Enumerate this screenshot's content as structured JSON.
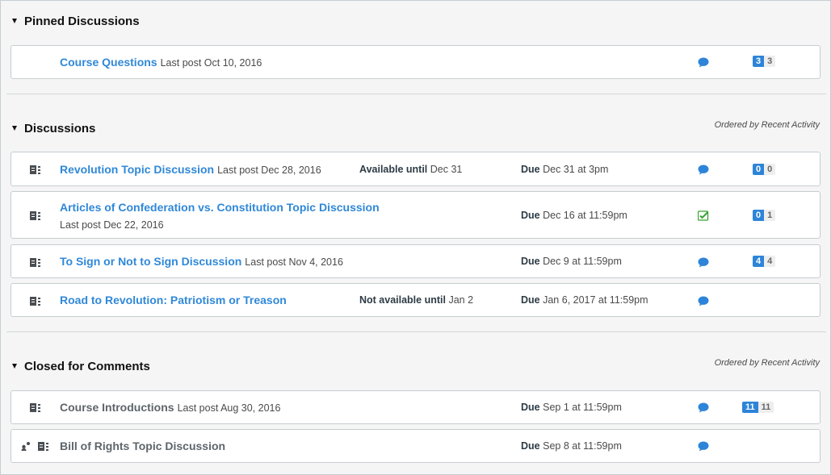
{
  "colors": {
    "link": "#3088d8",
    "badge_blue": "#2d84d8",
    "checked_green": "#37a22f",
    "subscribe_blue": "#2d84d8"
  },
  "pinned": {
    "title": "Pinned Discussions",
    "items": [
      {
        "title": "Course Questions",
        "last_post": "Last post Oct 10, 2016",
        "unread": "3",
        "total": "3",
        "status_icon": "speech-bubble-icon"
      }
    ]
  },
  "discussions": {
    "title": "Discussions",
    "ordered": "Ordered by Recent Activity",
    "items": [
      {
        "title": "Revolution Topic Discussion",
        "last_post": "Last post Dec 28, 2016",
        "avail_label": "Available until",
        "avail_date": "Dec 31",
        "due_label": "Due",
        "due_date": "Dec 31 at 3pm",
        "unread": "0",
        "total": "0",
        "status_icon": "speech-bubble-icon"
      },
      {
        "title": "Articles of Confederation vs. Constitution Topic Discussion",
        "last_post": "Last post Dec 22, 2016",
        "due_label": "Due",
        "due_date": "Dec 16 at 11:59pm",
        "unread": "0",
        "total": "1",
        "status_icon": "checked-icon"
      },
      {
        "title": "To Sign or Not to Sign Discussion",
        "last_post": "Last post Nov 4, 2016",
        "due_label": "Due",
        "due_date": "Dec 9 at 11:59pm",
        "unread": "4",
        "total": "4",
        "status_icon": "speech-bubble-icon"
      },
      {
        "title": "Road to Revolution: Patriotism or Treason",
        "avail_label": "Not available until",
        "avail_date": "Jan 2",
        "due_label": "Due",
        "due_date": "Jan 6, 2017 at 11:59pm",
        "status_icon": "speech-bubble-icon"
      }
    ]
  },
  "closed": {
    "title": "Closed for Comments",
    "ordered": "Ordered by Recent Activity",
    "items": [
      {
        "title": "Course Introductions",
        "last_post": "Last post Aug 30, 2016",
        "due_label": "Due",
        "due_date": "Sep 1 at 11:59pm",
        "unread": "11",
        "total": "11",
        "status_icon": "speech-bubble-icon"
      },
      {
        "title": "Bill of Rights Topic Discussion",
        "due_label": "Due",
        "due_date": "Sep 8 at 11:59pm",
        "status_icon": "speech-bubble-icon"
      }
    ]
  }
}
